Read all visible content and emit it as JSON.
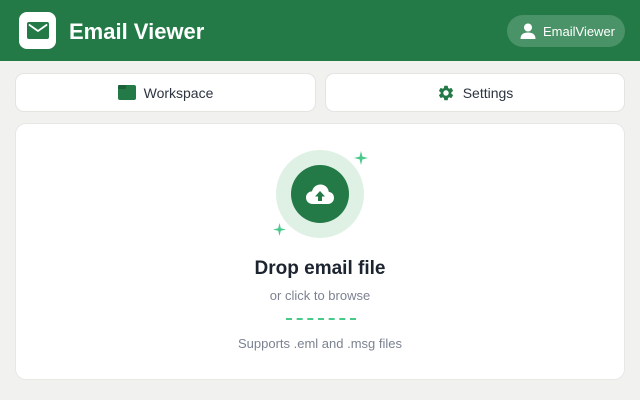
{
  "header": {
    "title": "Email Viewer",
    "logo_icon": "mail-icon",
    "user": {
      "label": "EmailViewer",
      "icon": "user-icon"
    }
  },
  "tabs": [
    {
      "label": "Workspace",
      "icon": "folder-icon"
    },
    {
      "label": "Settings",
      "icon": "gear-icon"
    }
  ],
  "dropzone": {
    "title": "Drop email file",
    "subtitle": "or click to browse",
    "support": "Supports .eml and .msg files",
    "icon": "cloud-upload-icon"
  },
  "colors": {
    "brand": "#237a47",
    "brand_light": "#dff0e5",
    "accent": "#48c98a",
    "background": "#f1f2ef",
    "text_dark": "#1c2430",
    "text_muted": "#7b8290"
  }
}
